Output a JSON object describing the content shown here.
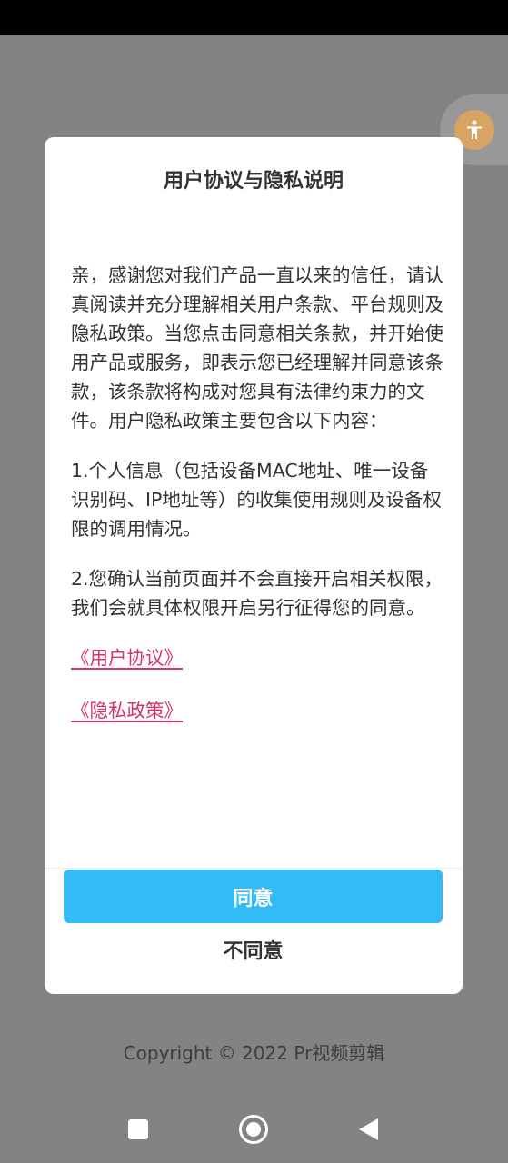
{
  "dialog": {
    "title": "用户协议与隐私说明",
    "paragraphs": [
      "亲，感谢您对我们产品一直以来的信任，请认真阅读并充分理解相关用户条款、平台规则及隐私政策。当您点击同意相关条款，并开始使用产品或服务，即表示您已经理解并同意该条款，该条款将构成对您具有法律约束力的文件。用户隐私政策主要包含以下内容：",
      "1.个人信息（包括设备MAC地址、唯一设备识别码、IP地址等）的收集使用规则及设备权限的调用情况。",
      "2.您确认当前页面并不会直接开启相关权限，我们会就具体权限开启另行征得您的同意。"
    ],
    "links": {
      "user_agreement": "《用户协议》",
      "privacy_policy": "《隐私政策》"
    },
    "buttons": {
      "agree": "同意",
      "disagree": "不同意"
    }
  },
  "footer": {
    "copyright": "Copyright © 2022 Pr视频剪辑"
  },
  "icons": {
    "accessibility": "accessibility-icon",
    "nav_recent": "recent-apps-icon",
    "nav_home": "home-icon",
    "nav_back": "back-icon"
  },
  "colors": {
    "accent": "#33bbf6",
    "link": "#d6336c",
    "overlay": "#838383"
  }
}
